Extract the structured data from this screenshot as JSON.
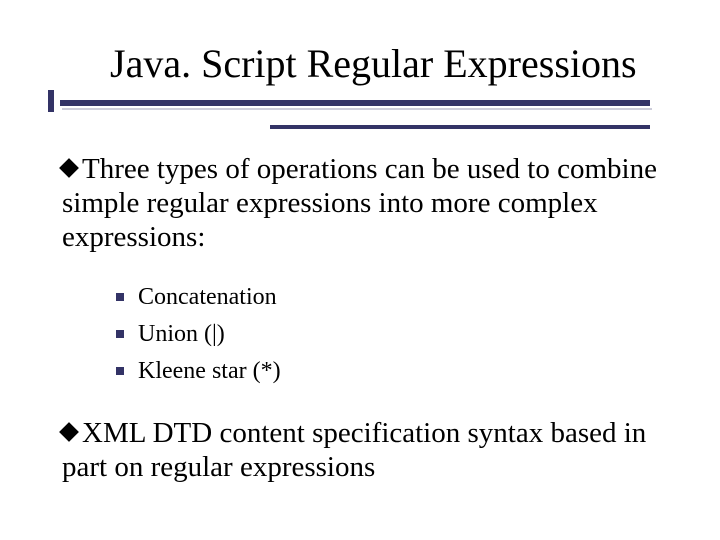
{
  "title": "Java. Script Regular Expressions",
  "bullets": {
    "b1": "Three types of operations can be used to combine simple regular expressions into more complex expressions:",
    "sub": {
      "s1": "Concatenation",
      "s2": "Union (|)",
      "s3": "Kleene star (*)"
    },
    "b2": "XML DTD content specification syntax based in part on regular expressions"
  }
}
